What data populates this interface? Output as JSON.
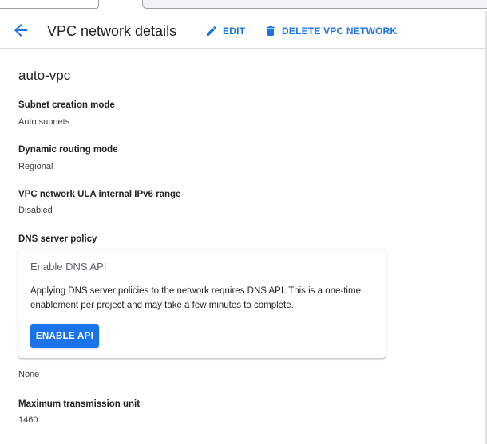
{
  "colors": {
    "accent": "#1a73e8",
    "text": "#202124",
    "muted": "#5f6368"
  },
  "header": {
    "back_icon": "arrow-back-icon",
    "title": "VPC network details",
    "edit_label": "EDIT",
    "edit_icon": "pencil-icon",
    "delete_label": "DELETE VPC NETWORK",
    "delete_icon": "trash-icon"
  },
  "network": {
    "name": "auto-vpc",
    "fields": [
      {
        "label": "Subnet creation mode",
        "value": "Auto subnets"
      },
      {
        "label": "Dynamic routing mode",
        "value": "Regional"
      },
      {
        "label": "VPC network ULA internal IPv6 range",
        "value": "Disabled"
      },
      {
        "label": "DNS server policy",
        "value": "None"
      },
      {
        "label": "Maximum transmission unit",
        "value": "1460"
      }
    ]
  },
  "dns_card": {
    "title": "Enable DNS API",
    "description": "Applying DNS server policies to the network requires DNS API. This is a one-time enablement per project and may take a few minutes to complete.",
    "button_label": "ENABLE API"
  }
}
